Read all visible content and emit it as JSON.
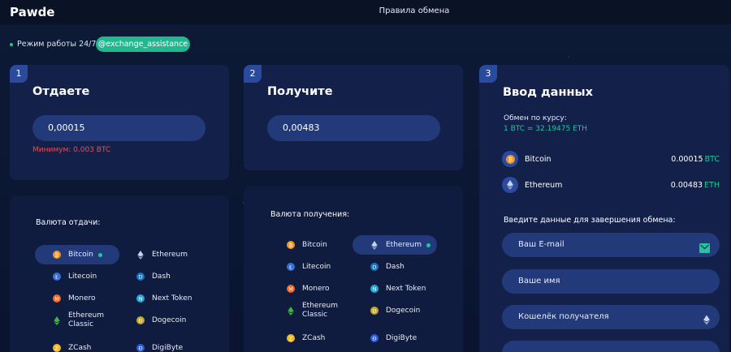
{
  "header": {
    "logo": "Pawde",
    "nav_link": "Правила обмена"
  },
  "status": {
    "mode_text": "Режим работы 24/7",
    "telegram": "@exchange_assistance"
  },
  "give": {
    "step": "1",
    "title": "Отдаете",
    "amount": "0,00015",
    "minimum": "Минимум: 0.003 BTC"
  },
  "receive": {
    "step": "2",
    "title": "Получите",
    "amount": "0,00483"
  },
  "give_currency": {
    "title": "Валюта отдачи:",
    "items": [
      "Bitcoin",
      "Ethereum",
      "Litecoin",
      "Dash",
      "Monero",
      "Next Token",
      "Ethereum Classic",
      "Dogecoin",
      "ZCash",
      "DigiByte"
    ],
    "selected": "Bitcoin"
  },
  "receive_currency": {
    "title": "Валюта получения:",
    "items": [
      "Bitcoin",
      "Ethereum",
      "Litecoin",
      "Dash",
      "Monero",
      "Next Token",
      "Ethereum Classic",
      "Dogecoin",
      "ZCash",
      "DigiByte"
    ],
    "selected": "Ethereum"
  },
  "data_entry": {
    "step": "3",
    "title": "Ввод данных",
    "rate_label": "Обмен по курсу:",
    "rate_value": "1 BTC = 32.19475 ETH",
    "summary": [
      {
        "name": "Bitcoin",
        "amount": "0.00015",
        "unit": "BTC"
      },
      {
        "name": "Ethereum",
        "amount": "0.00483",
        "unit": "ETH"
      }
    ],
    "form_title": "Введите данные для завершения обмена:",
    "email_placeholder": "Ваш E-mail",
    "name_placeholder": "Ваше имя",
    "wallet_placeholder": "Кошелёк получателя"
  },
  "icons": {
    "Bitcoin": "#f7931a",
    "Ethereum": "#8a93b2",
    "Litecoin": "#3a6fd6",
    "Dash": "#1c75bc",
    "Monero": "#f26822",
    "Next Token": "#25a7d6",
    "Ethereum Classic": "#3ab83a",
    "Dogecoin": "#c2a633",
    "ZCash": "#f4b728",
    "DigiByte": "#2a5ddb"
  }
}
